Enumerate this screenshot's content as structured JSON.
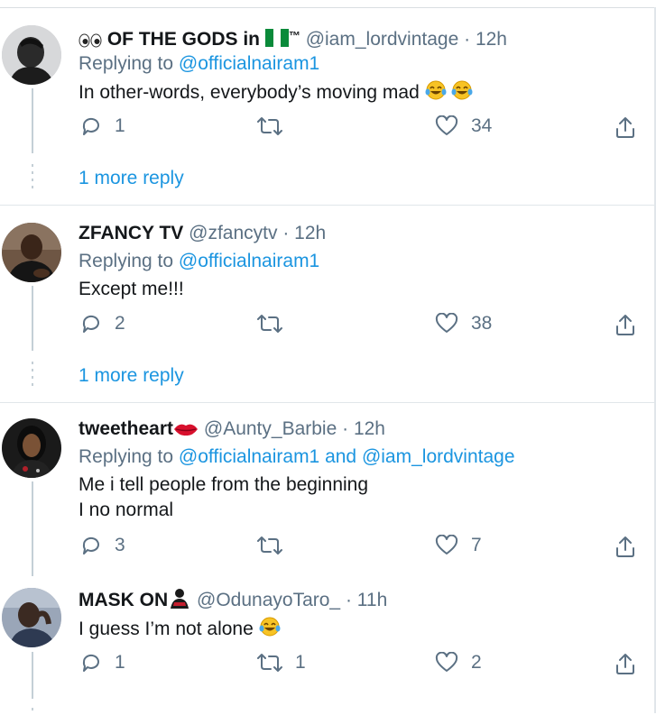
{
  "tweets": [
    {
      "name": "OF THE GODS in",
      "name_suffix": "™",
      "handle": "@iam_lordvintage",
      "time": "· 12h",
      "replying_prefix": "Replying to",
      "replying_to": "@officialnairam1",
      "text": "In other-words, everybody’s moving mad",
      "reply_count": "1",
      "retweet_count": "",
      "like_count": "34",
      "more_replies": "1 more reply",
      "icons": [
        "eyes-emoji",
        "nigeria-flag",
        "tears-of-joy-emoji"
      ]
    },
    {
      "name": "ZFANCY TV",
      "handle": "@zfancytv",
      "time": "· 12h",
      "replying_prefix": "Replying to",
      "replying_to": "@officialnairam1",
      "text": "Except me!!!",
      "reply_count": "2",
      "retweet_count": "",
      "like_count": "38",
      "more_replies": "1 more reply"
    },
    {
      "name": "tweetheart",
      "handle": "@Aunty_Barbie",
      "time": "· 12h",
      "replying_prefix": "Replying to",
      "replying_to": "@officialnairam1 and @iam_lordvintage",
      "text_line1": "Me i tell people from the beginning",
      "text_line2": "I no normal",
      "reply_count": "3",
      "retweet_count": "",
      "like_count": "7",
      "icons": [
        "lips-emoji"
      ]
    },
    {
      "name": "MASK ON",
      "handle": "@OdunayoTaro_",
      "time": "· 11h",
      "text": "I guess I’m not alone",
      "reply_count": "1",
      "retweet_count": "1",
      "like_count": "2",
      "icons": [
        "person-silhouette-emoji",
        "tears-of-joy-emoji"
      ]
    }
  ],
  "colors": {
    "link": "#1b95e0",
    "muted": "#5b7083",
    "text": "#14171a",
    "thread_line": "#c4cfd6",
    "divider": "#e1e6ea"
  }
}
